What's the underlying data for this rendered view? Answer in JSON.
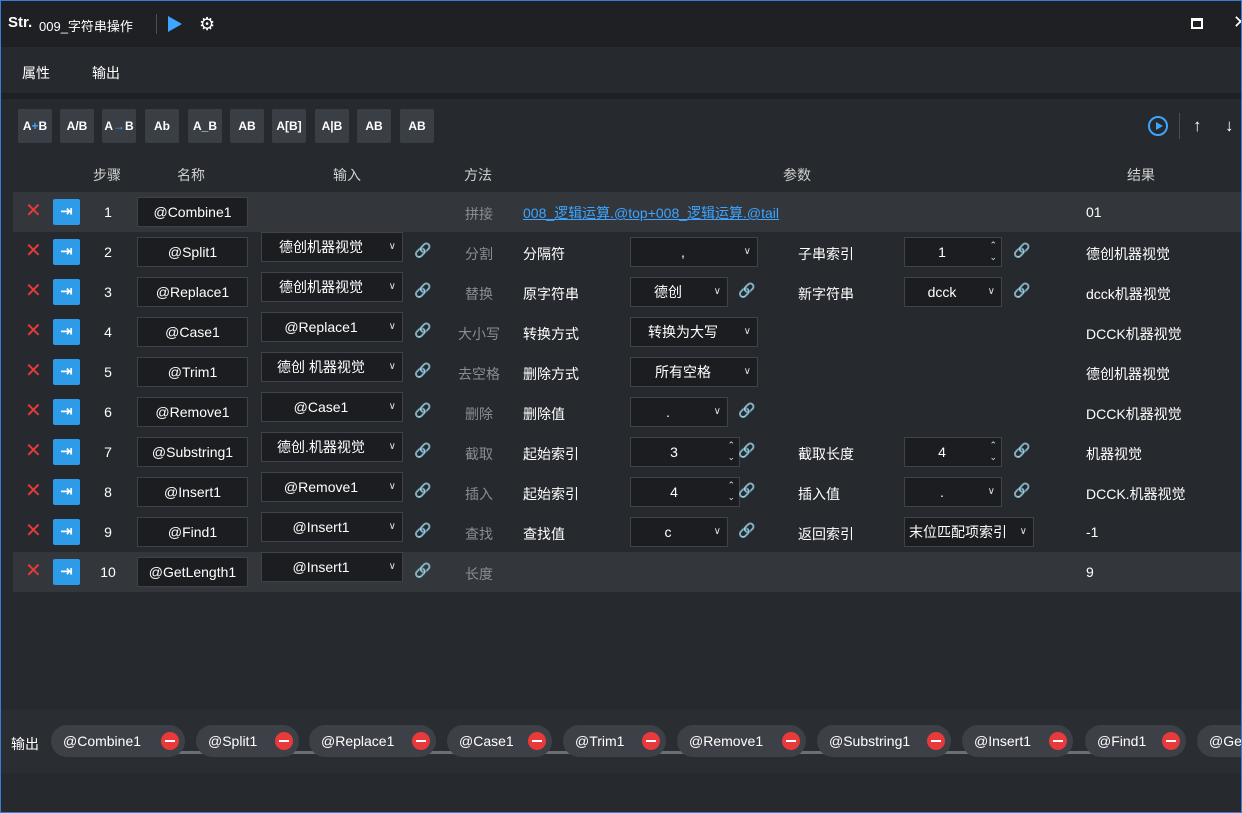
{
  "window": {
    "logo": "Str.",
    "title": "009_字符串操作"
  },
  "tabs": [
    {
      "label": "属性"
    },
    {
      "label": "输出"
    }
  ],
  "toolbar": [
    {
      "label": "A+B",
      "icon": "concat-icon"
    },
    {
      "label": "A/B",
      "icon": "split-icon"
    },
    {
      "label": "A→B",
      "icon": "replace-icon"
    },
    {
      "label": "Ab",
      "icon": "case-icon"
    },
    {
      "label": "A_B",
      "icon": "trim-icon"
    },
    {
      "label": "AB",
      "icon": "remove-icon"
    },
    {
      "label": "A[B]",
      "icon": "substring-icon"
    },
    {
      "label": "A|B",
      "icon": "insert-icon"
    },
    {
      "label": "AB",
      "icon": "find-icon"
    },
    {
      "label": "AB",
      "icon": "length-icon"
    }
  ],
  "headers": {
    "step": "步骤",
    "name": "名称",
    "input": "输入",
    "method": "方法",
    "params": "参数",
    "result": "结果"
  },
  "rows": [
    {
      "step": "1",
      "name": "@Combine1",
      "input": "",
      "method": "拼接",
      "formula": "008_逻辑运算.@top+008_逻辑运算.@tail",
      "result": "01"
    },
    {
      "step": "2",
      "name": "@Split1",
      "input": "德创机器视觉",
      "method": "分割",
      "p1label": "分隔符",
      "p1": ",",
      "p2label": "子串索引",
      "p2": "1",
      "result": "德创机器视觉"
    },
    {
      "step": "3",
      "name": "@Replace1",
      "input": "德创机器视觉",
      "method": "替换",
      "p1label": "原字符串",
      "p1": "德创",
      "p2label": "新字符串",
      "p2": "dcck",
      "result": "dcck机器视觉"
    },
    {
      "step": "4",
      "name": "@Case1",
      "input": "@Replace1",
      "method": "大小写",
      "p1label": "转换方式",
      "p1": "转换为大写",
      "result": "DCCK机器视觉"
    },
    {
      "step": "5",
      "name": "@Trim1",
      "input": "德创 机器视觉",
      "method": "去空格",
      "p1label": "删除方式",
      "p1": "所有空格",
      "result": "德创机器视觉"
    },
    {
      "step": "6",
      "name": "@Remove1",
      "input": "@Case1",
      "method": "删除",
      "p1label": "删除值",
      "p1": ".",
      "result": "DCCK机器视觉"
    },
    {
      "step": "7",
      "name": "@Substring1",
      "input": "德创.机器视觉",
      "method": "截取",
      "p1label": "起始索引",
      "p1": "3",
      "p2label": "截取长度",
      "p2": "4",
      "result": "机器视觉"
    },
    {
      "step": "8",
      "name": "@Insert1",
      "input": "@Remove1",
      "method": "插入",
      "p1label": "起始索引",
      "p1": "4",
      "p2label": "插入值",
      "p2": ".",
      "result": "DCCK.机器视觉"
    },
    {
      "step": "9",
      "name": "@Find1",
      "input": "@Insert1",
      "method": "查找",
      "p1label": "查找值",
      "p1": "c",
      "p2label": "返回索引",
      "p2": "末位匹配项索引",
      "result": "-1"
    },
    {
      "step": "10",
      "name": "@GetLength1",
      "input": "@Insert1",
      "method": "长度",
      "result": "9"
    }
  ],
  "output": {
    "label": "输出",
    "chips": [
      "@Combine1",
      "@Split1",
      "@Replace1",
      "@Case1",
      "@Trim1",
      "@Remove1",
      "@Substring1",
      "@Insert1",
      "@Find1",
      "@Ge"
    ]
  },
  "colors": {
    "accent": "#3da5ff",
    "delete": "#e8393b",
    "bg": "#26292d"
  }
}
